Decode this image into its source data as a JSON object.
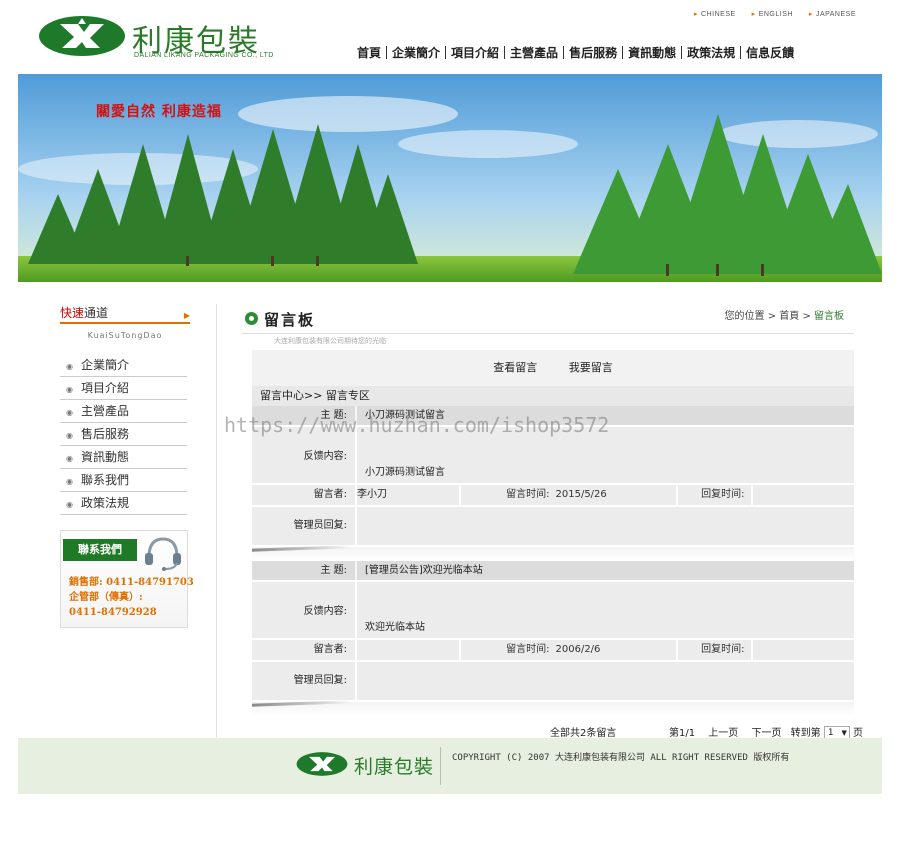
{
  "header": {
    "logo_cn": "利康包裝",
    "logo_en": "DALIAN LIKANG PACKAGING CO., LTD",
    "languages": [
      "CHINESE",
      "ENGLISH",
      "JAPANESE"
    ],
    "nav": [
      "首頁",
      "企業簡介",
      "項目介紹",
      "主營產品",
      "售后服務",
      "資訊動態",
      "政策法規",
      "信息反饋"
    ]
  },
  "banner": {
    "slogan": "關愛自然  利康造福"
  },
  "sidebar": {
    "quick_title_red": "快速",
    "quick_title_black": "通道",
    "quick_subtitle": "KuaiSuTongDao",
    "items": [
      "企業簡介",
      "項目介紹",
      "主營產品",
      "售后服務",
      "資訊動態",
      "聯系我們",
      "政策法規"
    ],
    "contact": {
      "title": "聯系我們",
      "line1": "銷售部:  0411-84791703",
      "line2": "企管部（傳真）:",
      "line3": "0411-84792928"
    }
  },
  "content": {
    "title": "留言板",
    "tagline": "大连利康包装有限公司期待您的光临",
    "breadcrumb": {
      "prefix": "您的位置",
      "home": "首頁",
      "current": "留言板"
    },
    "tabs": [
      "查看留言",
      "我要留言"
    ],
    "section_head": "留言中心>> 留言专区",
    "labels": {
      "subject": "主    题:",
      "content": "反馈内容:",
      "author": "留言者:",
      "time": "留言时间:",
      "reply_time": "回复时间:",
      "admin_reply": "管理员回复:"
    },
    "entries": [
      {
        "subject": "小刀源码测试留言",
        "content": "小刀源码测试留言",
        "author": "李小刀",
        "time": "2015/5/26",
        "reply_time": "",
        "admin_reply": ""
      },
      {
        "subject": "[管理员公告]欢迎光临本站",
        "content": "欢迎光临本站",
        "author": "",
        "time": "2006/2/6",
        "reply_time": "",
        "admin_reply": ""
      }
    ],
    "pager": {
      "total": "全部共2条留言",
      "page_info": "第1/1",
      "prev": "上一页",
      "next": "下一页",
      "goto": "转到第",
      "page_value": "1",
      "page_suffix": "页"
    }
  },
  "footer": {
    "logo_cn": "利康包裝",
    "copyright": "COPYRIGHT (C) 2007 大连利康包装有限公司 ALL RIGHT RESERVED  版权所有"
  },
  "watermark": "https://www.huzhan.com/ishop3572",
  "colors": {
    "brand_green": "#2a7a2a",
    "accent_orange": "#e07000",
    "slogan_red": "#d41010"
  }
}
